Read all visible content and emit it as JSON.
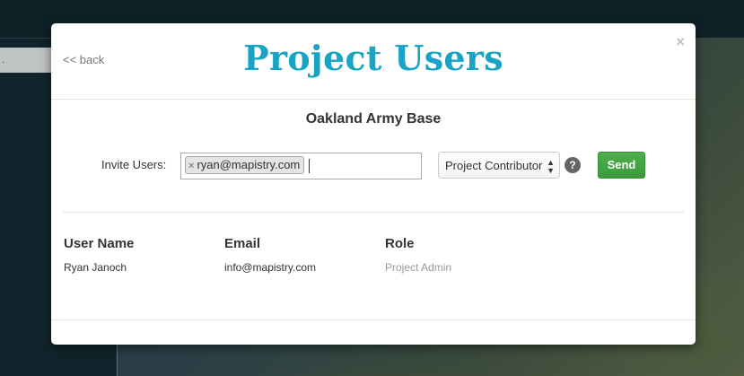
{
  "background": {
    "left_item_label": "."
  },
  "modal": {
    "back_label": "<< back",
    "title": "Project Users",
    "close_label": "×",
    "project_name": "Oakland Army Base"
  },
  "invite": {
    "label": "Invite Users:",
    "tags": [
      "ryan@mapistry.com"
    ],
    "tag_remove_label": "×",
    "role_selected": "Project Contributor",
    "help_label": "?",
    "send_label": "Send"
  },
  "users_table": {
    "headers": [
      "User Name",
      "Email",
      "Role"
    ],
    "rows": [
      {
        "name": "Ryan Janoch",
        "email": "info@mapistry.com",
        "role": "Project Admin"
      }
    ]
  },
  "colors": {
    "title": "#19a3c4",
    "send_button": "#45a845",
    "help_icon": "#666666"
  }
}
